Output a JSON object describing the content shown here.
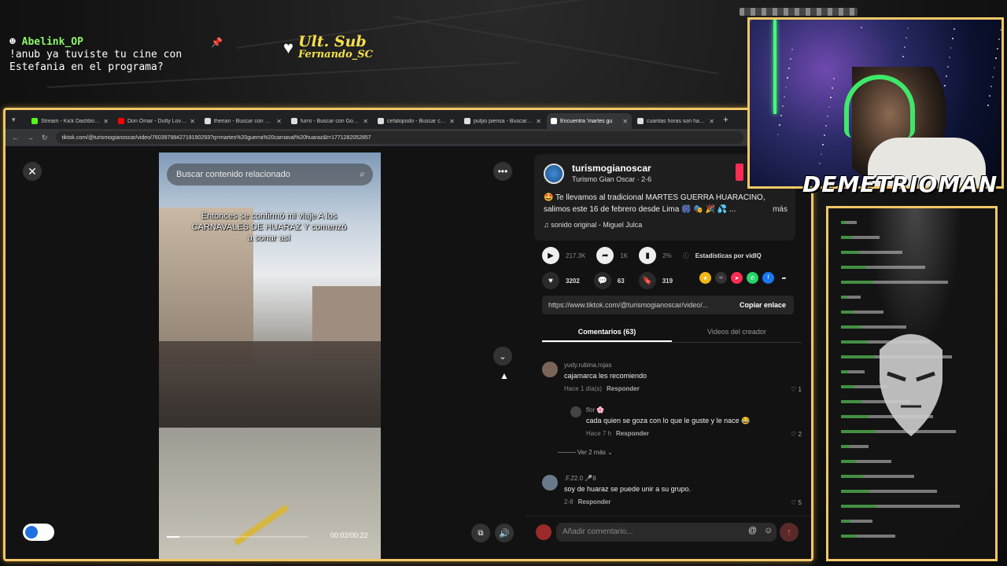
{
  "overlay": {
    "chat_user": "Abelink_OP",
    "chat_message": "!anub ya tuviste tu cine con Estefania en el programa?",
    "sub_title": "Ult. Sub",
    "sub_name": "Fernando_SC",
    "streamer_name": "DEMETRIOMAN"
  },
  "browser": {
    "tabs": [
      {
        "label": "Stream - Kick Dashboard",
        "color": "#53fc18",
        "active": false
      },
      {
        "label": "Don Omar - Dutty Love (L",
        "color": "#ff0000",
        "active": false
      },
      {
        "label": "therian - Buscar con Goog",
        "color": "#dddddd",
        "active": false
      },
      {
        "label": "furro - Buscar con Google",
        "color": "#dddddd",
        "active": false
      },
      {
        "label": "cefalopodo - Buscar con",
        "color": "#dddddd",
        "active": false
      },
      {
        "label": "pulpo piensa - Buscar con",
        "color": "#dddddd",
        "active": false
      },
      {
        "label": "Encuentra 'martes gu",
        "color": "#ffffff",
        "active": true
      },
      {
        "label": "cuantas horas son hasta",
        "color": "#dddddd",
        "active": false
      }
    ],
    "url": "tiktok.com/@turismogianoscar/video/7603979842719190293?q=martes%20guerra%20carnaval%20huaraz&t=1771282052857"
  },
  "video": {
    "search_placeholder": "Buscar contenido relacionado",
    "caption": "Entonces se confirmó mi viaje A los CARNAVALES DE HUARAZ Y comenzó a sonar así",
    "time": "00:02/00:22",
    "progress": 0.09
  },
  "post": {
    "username": "turismogianoscar",
    "subline": "Turismo Gian Oscar · 2-6",
    "description": "🤩 Te llevamos al tradicional MARTES GUERRA HUARACINO, salimos este 16 de febrero desde Lima 🎆 🎭 🎉 💦 ...",
    "more": "más",
    "sound": "♫  sonido original - Miguel Julca",
    "plays": "217.3K",
    "shares_count": "1K",
    "stat_pct": "2%",
    "stats_label": "Estadísticas por vidIQ",
    "likes": "3202",
    "comments_count": "63",
    "saves": "319",
    "link": "https://www.tiktok.com/@turismogianoscar/video/...",
    "copy_label": "Copiar enlace",
    "tab_comments": "Comentarios (63)",
    "tab_videos": "Videos del creador"
  },
  "comments": [
    {
      "user": "yudy.rubina.rojas",
      "text": "cajamarca les recomiendo",
      "time": "Hace 1 día(s)",
      "reply": "Responder",
      "likes": "1"
    },
    {
      "user": "flor 🌸",
      "text": "cada quien se goza con lo que le guste y le nace 😂",
      "time": "Hace 7 h",
      "reply": "Responder",
      "likes": "2"
    },
    {
      "user": ".F.22.0 🎤8",
      "text": "soy de huaraz se puede unir a su grupo.",
      "time": "2-8",
      "reply": "Responder",
      "likes": "5"
    }
  ],
  "more_replies": "Ver 2 más",
  "add_comment_placeholder": "Añadir comentario...",
  "colors": {
    "accent": "#f3c866",
    "tiktok_red": "#fe2c55",
    "chat_green": "#8cf56a"
  }
}
